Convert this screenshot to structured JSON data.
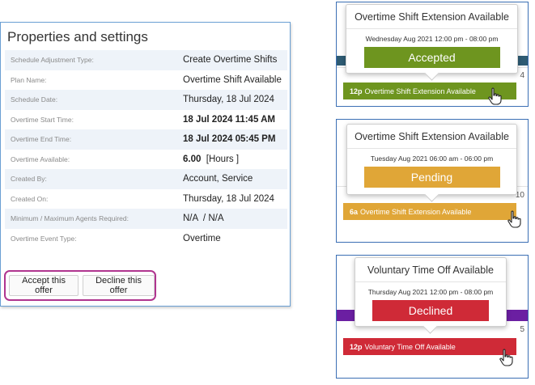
{
  "panel": {
    "title": "Properties and settings",
    "rows": [
      {
        "label": "Schedule Adjustment Type:",
        "value": "Create Overtime Shifts"
      },
      {
        "label": "Plan Name:",
        "value": "Overtime Shift Available"
      },
      {
        "label": "Schedule Date:",
        "value": "Thursday, 18 Jul 2024"
      },
      {
        "label": "Overtime Start Time:",
        "value": "18 Jul 2024 11:45 AM"
      },
      {
        "label": "Overtime End Time:",
        "value": "18 Jul 2024 05:45 PM"
      },
      {
        "label": "Overtime Available:",
        "value": "6.00",
        "unit": "[Hours ]"
      },
      {
        "label": "Created By:",
        "value": "Account, Service"
      },
      {
        "label": "Created On:",
        "value": "Thursday, 18 Jul 2024"
      },
      {
        "label": "Minimum / Maximum Agents Required:",
        "value": "N/A  / N/A"
      },
      {
        "label": "Overtime Event Type:",
        "value": "Overtime"
      }
    ],
    "accept_label": "Accept this offer",
    "decline_label": "Decline this offer"
  },
  "cards": [
    {
      "tooltip_title": "Overtime Shift Extension Available",
      "tooltip_date": "Wednesday Aug 2021 12:00 pm - 08:00 pm",
      "status": "Accepted",
      "day": "4",
      "event_time": "12p",
      "event_label": "Overtime Shift Extension Available",
      "color": "#6e951f"
    },
    {
      "tooltip_title": "Overtime Shift Extension Available",
      "tooltip_date": "Tuesday Aug 2021 06:00 am - 06:00 pm",
      "status": "Pending",
      "day": "10",
      "event_time": "6a",
      "event_label": "Overtime Shift Extension Available",
      "color": "#e0a637"
    },
    {
      "tooltip_title": "Voluntary Time Off Available",
      "tooltip_date": "Thursday Aug 2021 12:00 pm - 08:00 pm",
      "status": "Declined",
      "day": "5",
      "event_time": "12p",
      "event_label": "Voluntary Time Off Available",
      "color": "#cf2a37"
    }
  ],
  "icons": {
    "cursor": "hand-pointer-icon"
  }
}
